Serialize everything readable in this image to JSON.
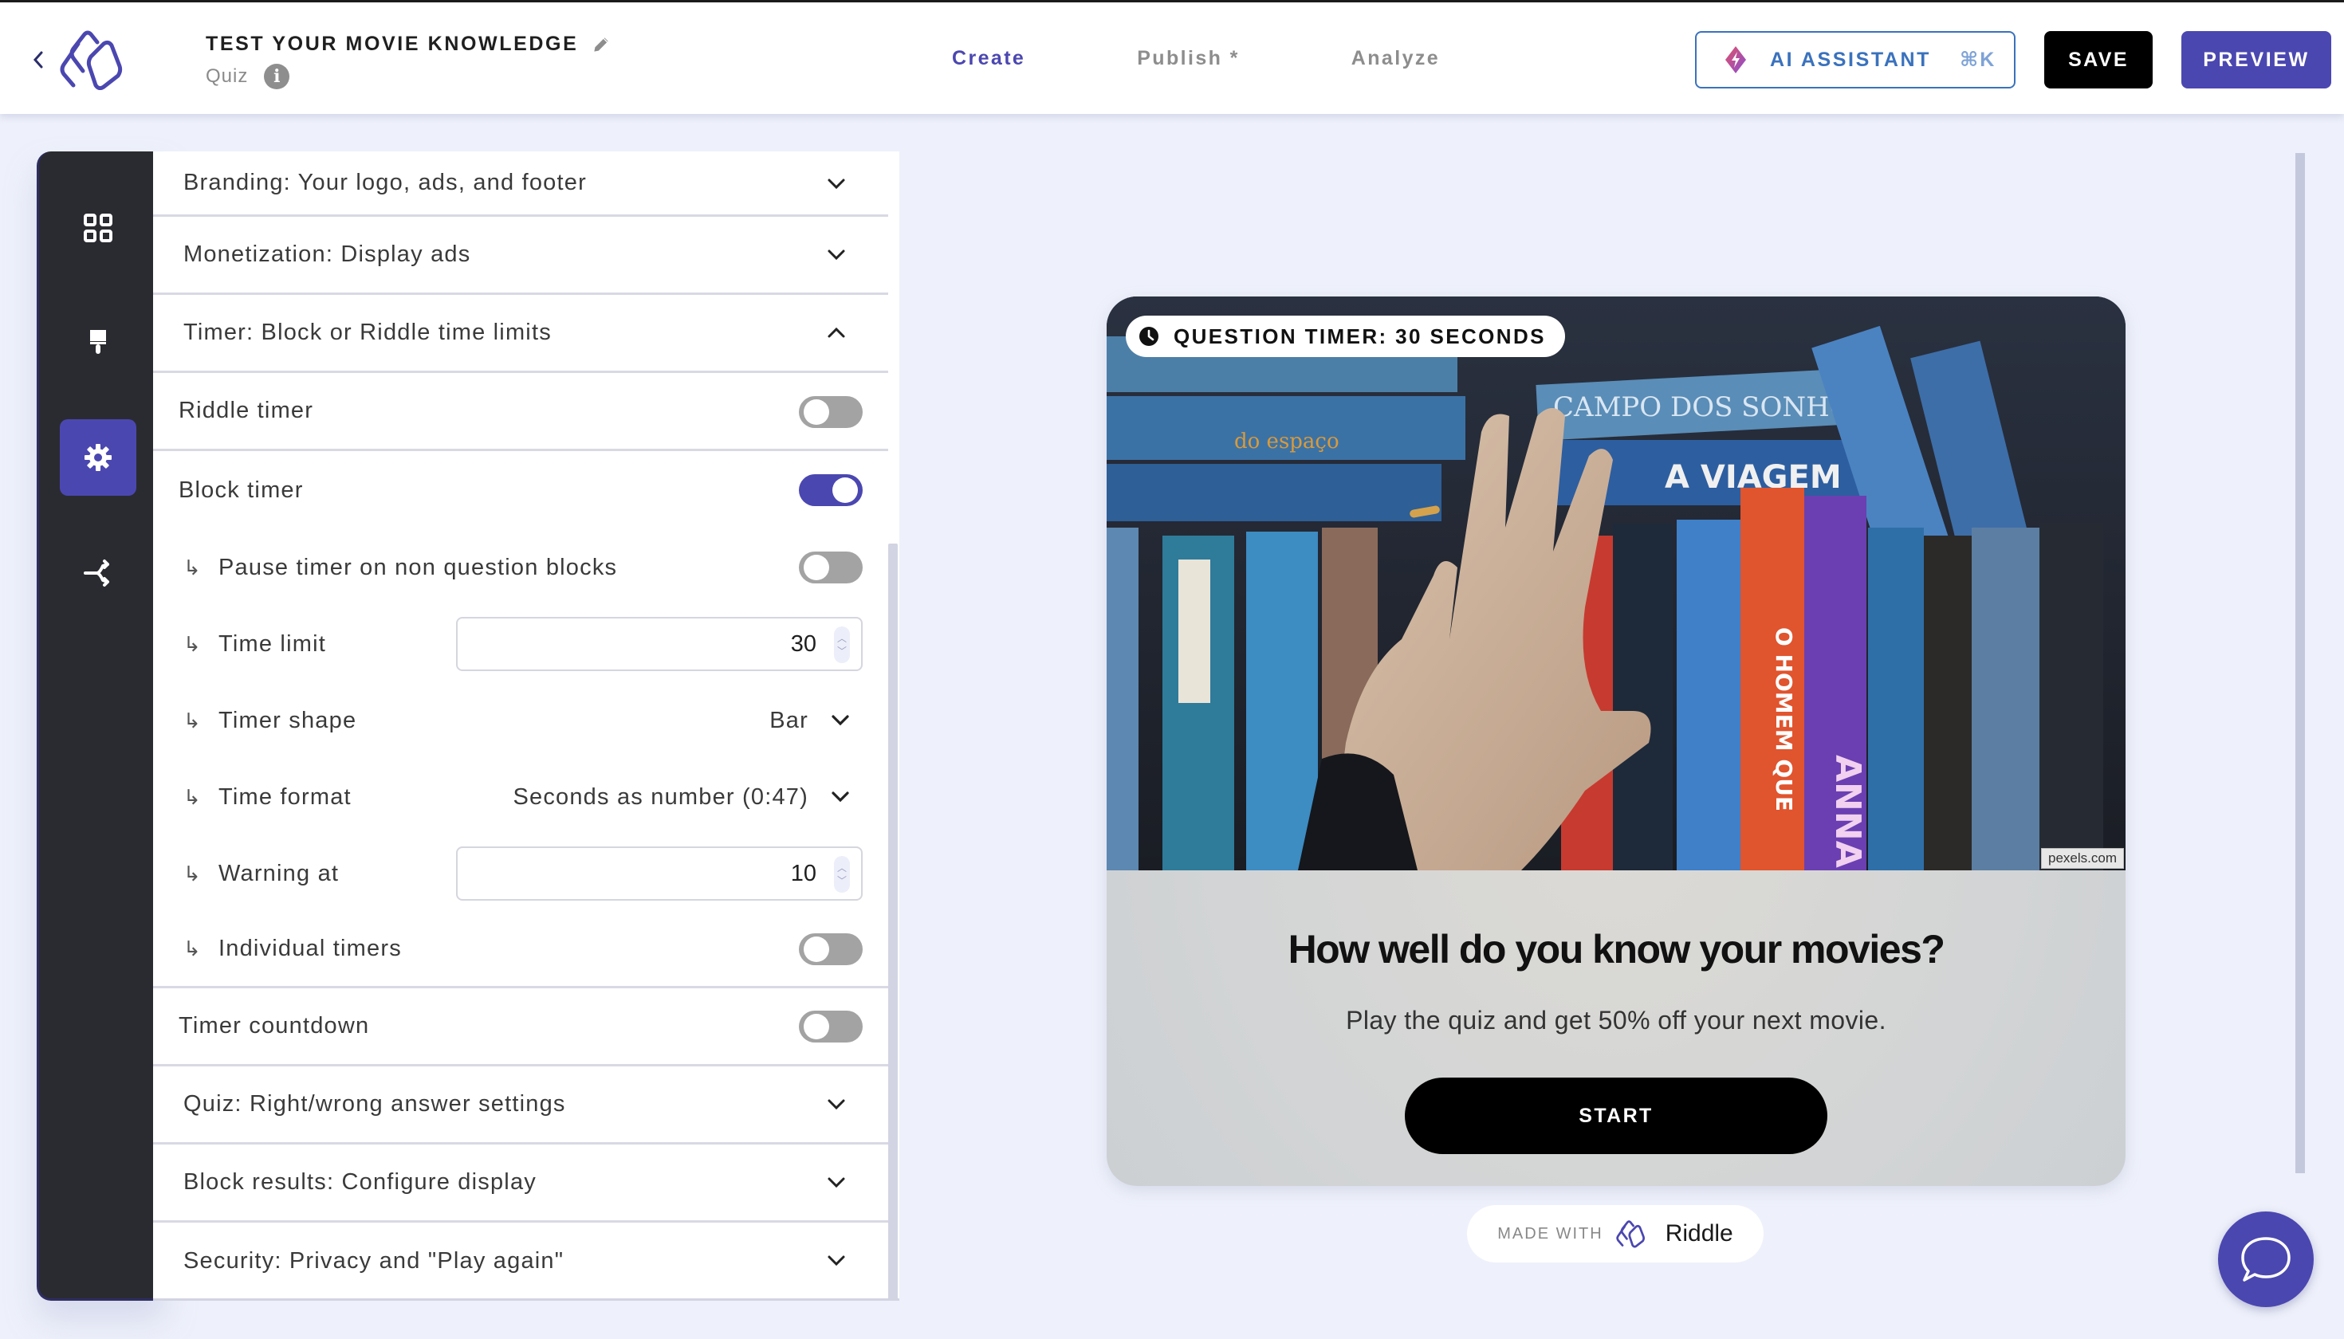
{
  "header": {
    "back_icon": "chevron-left-icon",
    "logo": "riddle-logo",
    "title": "TEST YOUR MOVIE KNOWLEDGE",
    "edit_icon": "pencil-icon",
    "subtitle": "Quiz",
    "info_icon": "info-icon",
    "tabs": [
      {
        "label": "Create",
        "active": true
      },
      {
        "label": "Publish *",
        "active": false
      },
      {
        "label": "Analyze",
        "active": false
      }
    ],
    "ai_assistant": {
      "label": "AI ASSISTANT",
      "shortcut": "⌘K",
      "icon": "lightning-diamond-icon"
    },
    "save_label": "SAVE",
    "preview_label": "PREVIEW"
  },
  "sidebar": {
    "items": [
      {
        "name": "blocks",
        "icon": "grid-icon",
        "active": false
      },
      {
        "name": "design",
        "icon": "paintbrush-icon",
        "active": false
      },
      {
        "name": "settings",
        "icon": "gear-icon",
        "active": true
      },
      {
        "name": "flow",
        "icon": "branch-icon",
        "active": false
      }
    ]
  },
  "settings": {
    "sections": {
      "branding": "Branding: Your logo, ads, and footer",
      "monetization": "Monetization: Display ads",
      "timer": "Timer: Block or Riddle time limits",
      "quiz": "Quiz: Right/wrong answer settings",
      "block_results": "Block results: Configure display",
      "security": "Security: Privacy and \"Play again\""
    },
    "timer": {
      "riddle_timer": {
        "label": "Riddle timer",
        "on": false
      },
      "block_timer": {
        "label": "Block timer",
        "on": true
      },
      "pause_timer": {
        "label": "Pause timer on non question blocks",
        "on": false
      },
      "time_limit": {
        "label": "Time limit",
        "value": "30"
      },
      "timer_shape": {
        "label": "Timer shape",
        "value": "Bar"
      },
      "time_format": {
        "label": "Time format",
        "value": "Seconds as number (0:47)"
      },
      "warning_at": {
        "label": "Warning at",
        "value": "10"
      },
      "individual_timers": {
        "label": "Individual timers",
        "on": false
      },
      "timer_countdown": {
        "label": "Timer countdown",
        "on": false
      },
      "sub_arrow": "↳"
    }
  },
  "preview": {
    "timer_badge": "QUESTION TIMER: 30 SECONDS",
    "image_credit": "pexels.com",
    "image_description": "Hand reaching across shelf of VHS tapes",
    "title": "How well do you know your movies?",
    "description": "Play the quiz and get 50% off your next movie.",
    "start_label": "START",
    "made_with": "MADE WITH",
    "brand": "Riddle"
  },
  "colors": {
    "accent": "#4b47b0",
    "ai_blue": "#3a72bd",
    "nav_dark": "#2a2b30",
    "background": "#eef1fb"
  }
}
